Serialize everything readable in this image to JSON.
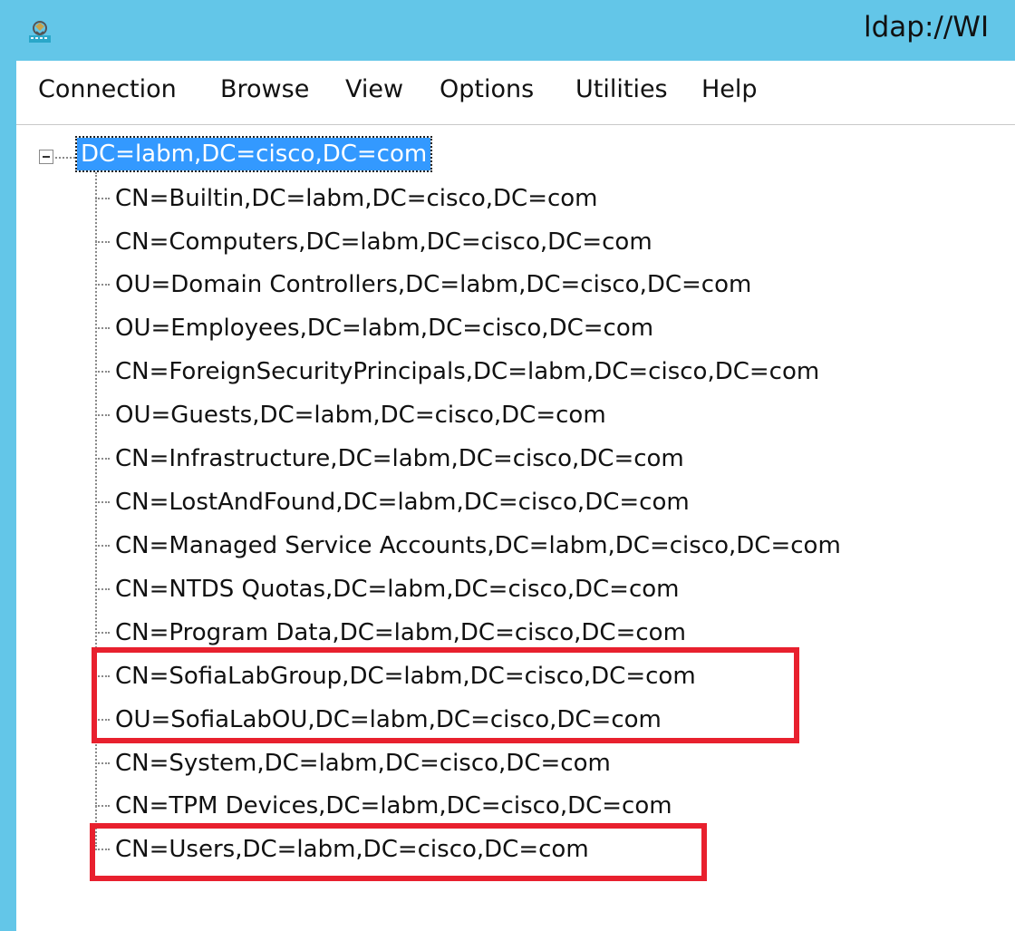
{
  "window": {
    "title": "ldap://WI"
  },
  "menu": {
    "items": [
      "Connection",
      "Browse",
      "View",
      "Options",
      "Utilities",
      "Help"
    ]
  },
  "tree": {
    "root": "DC=labm,DC=cisco,DC=com",
    "children": [
      "CN=Builtin,DC=labm,DC=cisco,DC=com",
      "CN=Computers,DC=labm,DC=cisco,DC=com",
      "OU=Domain Controllers,DC=labm,DC=cisco,DC=com",
      "OU=Employees,DC=labm,DC=cisco,DC=com",
      "CN=ForeignSecurityPrincipals,DC=labm,DC=cisco,DC=com",
      "OU=Guests,DC=labm,DC=cisco,DC=com",
      "CN=Infrastructure,DC=labm,DC=cisco,DC=com",
      "CN=LostAndFound,DC=labm,DC=cisco,DC=com",
      "CN=Managed Service Accounts,DC=labm,DC=cisco,DC=com",
      "CN=NTDS Quotas,DC=labm,DC=cisco,DC=com",
      "CN=Program Data,DC=labm,DC=cisco,DC=com",
      "CN=SofiaLabGroup,DC=labm,DC=cisco,DC=com",
      "OU=SofiaLabOU,DC=labm,DC=cisco,DC=com",
      "CN=System,DC=labm,DC=cisco,DC=com",
      "CN=TPM Devices,DC=labm,DC=cisco,DC=com",
      "CN=Users,DC=labm,DC=cisco,DC=com"
    ]
  },
  "colors": {
    "titlebar": "#63c6e8",
    "selection": "#3399ff",
    "annotation": "#e8202e"
  }
}
